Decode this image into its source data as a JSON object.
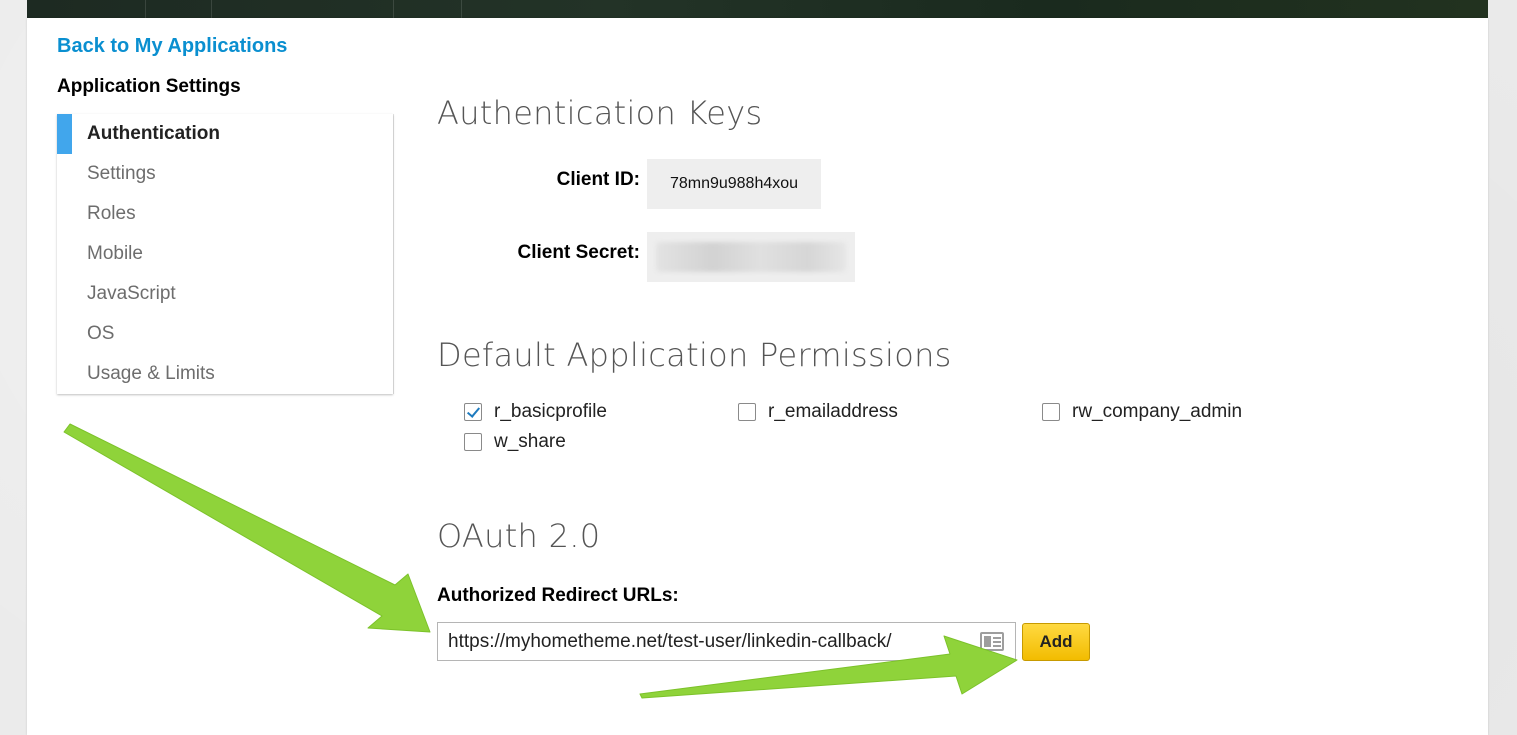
{
  "header": {
    "back_link": "Back to My Applications",
    "settings_title": "Application Settings"
  },
  "sidebar": {
    "items": [
      {
        "label": "Authentication",
        "active": true
      },
      {
        "label": "Settings"
      },
      {
        "label": "Roles"
      },
      {
        "label": "Mobile"
      },
      {
        "label": "JavaScript"
      },
      {
        "label": "OS"
      },
      {
        "label": "Usage & Limits"
      }
    ]
  },
  "auth_keys": {
    "title": "Authentication Keys",
    "client_id_label": "Client ID:",
    "client_id_value": "78mn9u988h4xou",
    "client_secret_label": "Client Secret:",
    "client_secret_state": "blurred"
  },
  "permissions": {
    "title": "Default Application Permissions",
    "items": [
      {
        "label": "r_basicprofile",
        "checked": true
      },
      {
        "label": "r_emailaddress",
        "checked": false
      },
      {
        "label": "rw_company_admin",
        "checked": false
      },
      {
        "label": "w_share",
        "checked": false
      }
    ]
  },
  "oauth2": {
    "title": "OAuth 2.0",
    "redirect_label": "Authorized Redirect URLs:",
    "redirect_value": "https://myhometheme.net/test-user/linkedin-callback/",
    "add_label": "Add"
  },
  "colors": {
    "link": "#0a8fd0",
    "active_bar": "#41a6ec",
    "add_button": "#f5c400",
    "arrow": "#8fd33a"
  },
  "icons": {
    "autofill": "contact-card-icon",
    "checkmark": "check-icon"
  }
}
